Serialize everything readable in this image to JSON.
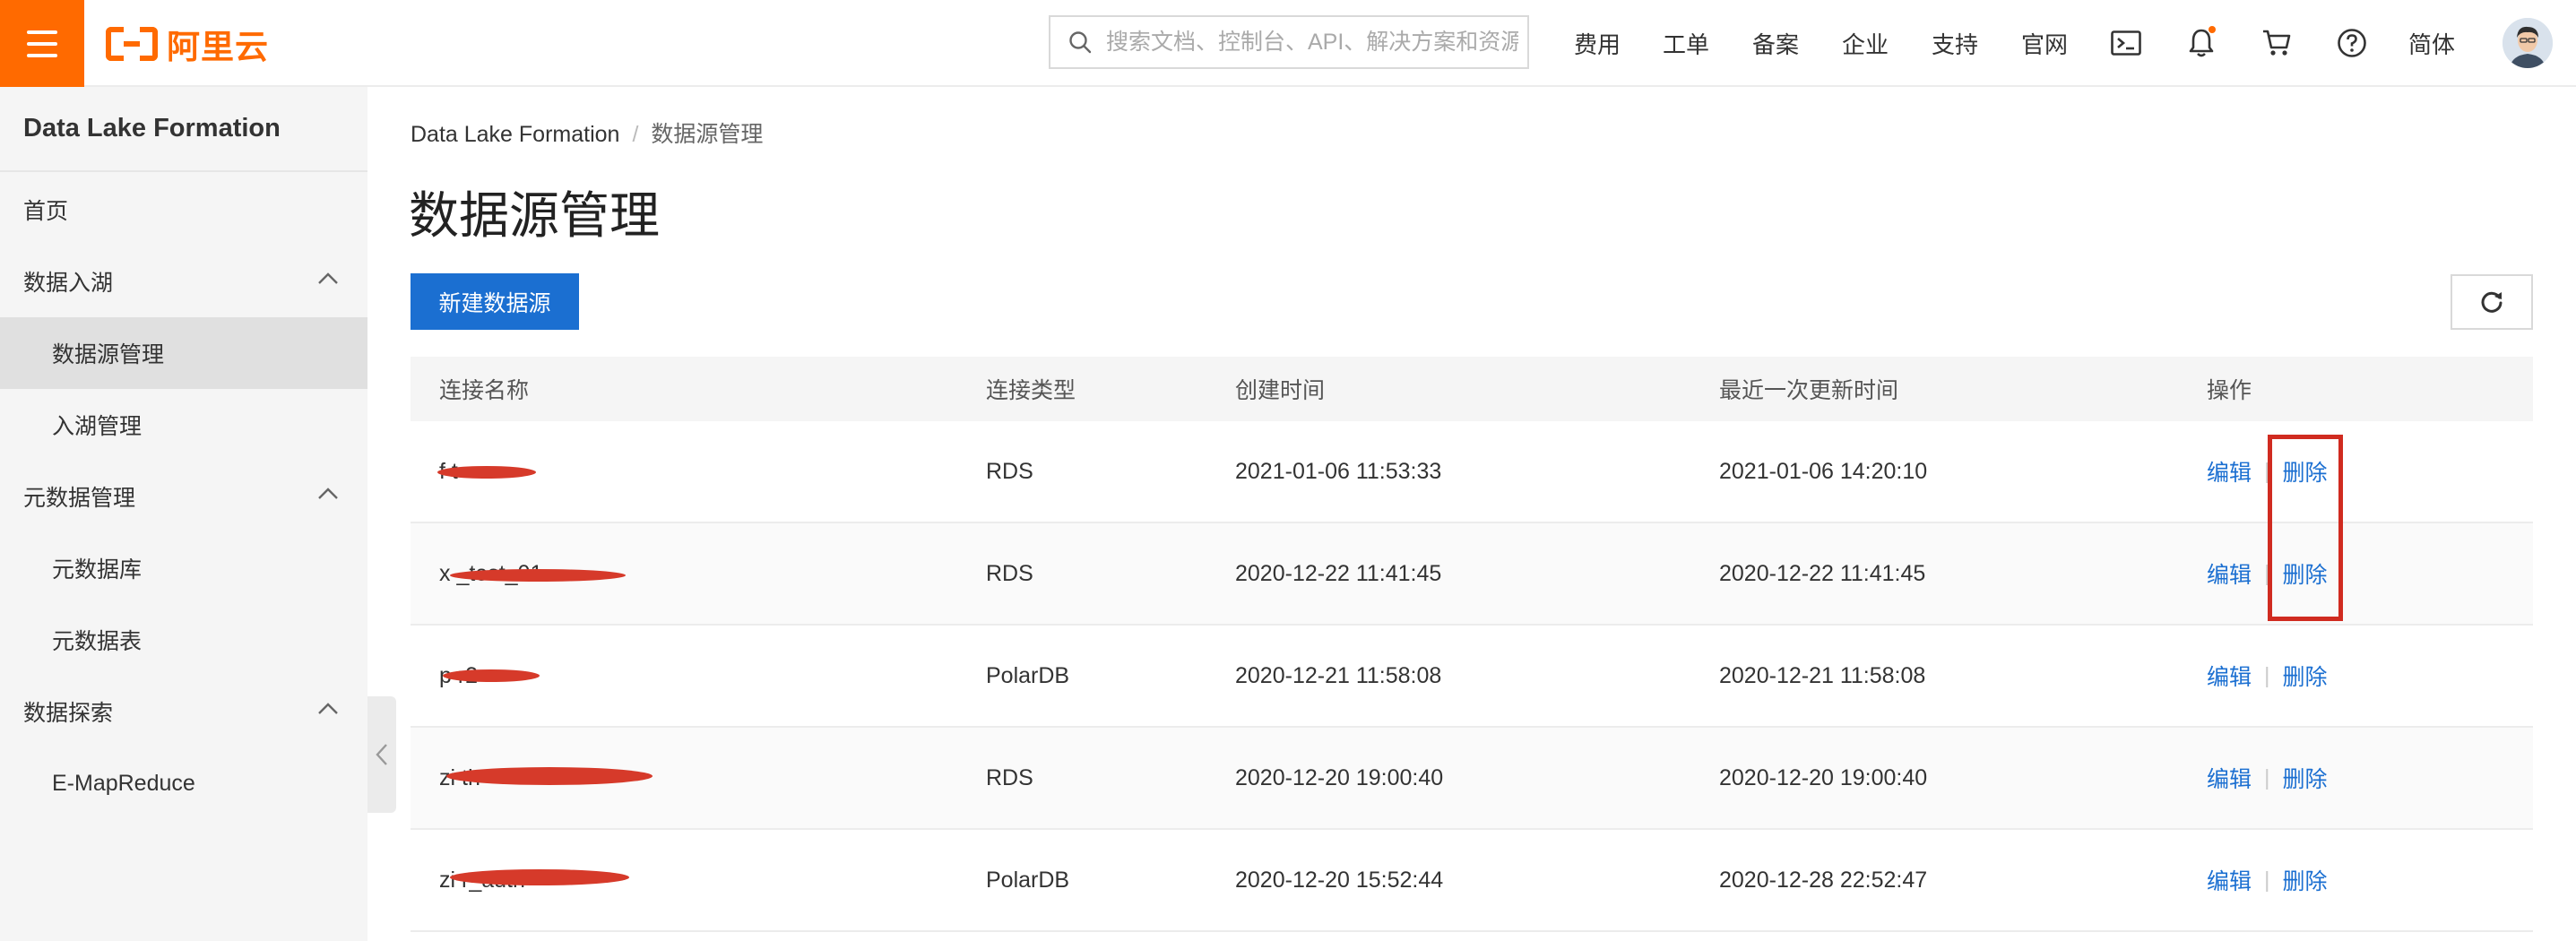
{
  "header": {
    "logo_text": "阿里云",
    "search_placeholder": "搜索文档、控制台、API、解决方案和资源",
    "links": [
      "费用",
      "工单",
      "备案",
      "企业",
      "支持",
      "官网"
    ],
    "lang": "简体",
    "icons": [
      "menu-icon",
      "search-icon",
      "terminal-icon",
      "bell-icon",
      "cart-icon",
      "help-icon",
      "avatar"
    ],
    "accent": "#ff6a00"
  },
  "sidebar": {
    "title": "Data Lake Formation",
    "items": [
      {
        "label": "首页",
        "level": 1
      },
      {
        "label": "数据入湖",
        "level": 1,
        "expanded": true
      },
      {
        "label": "数据源管理",
        "level": 2,
        "active": true
      },
      {
        "label": "入湖管理",
        "level": 2
      },
      {
        "label": "元数据管理",
        "level": 1,
        "expanded": true
      },
      {
        "label": "元数据库",
        "level": 2
      },
      {
        "label": "元数据表",
        "level": 2
      },
      {
        "label": "数据探索",
        "level": 1,
        "expanded": true
      },
      {
        "label": "E-MapReduce",
        "level": 2
      }
    ]
  },
  "breadcrumb": {
    "root": "Data Lake Formation",
    "separator": "/",
    "current": "数据源管理"
  },
  "page": {
    "title": "数据源管理",
    "new_button": "新建数据源",
    "primary_color": "#1b6fd1"
  },
  "table": {
    "columns": [
      "连接名称",
      "连接类型",
      "创建时间",
      "最近一次更新时间",
      "操作"
    ],
    "rows": [
      {
        "name": "f          t",
        "type": "RDS",
        "created": "2021-01-06 11:53:33",
        "updated": "2021-01-06 14:20:10",
        "edit": "编辑",
        "delete": "删除"
      },
      {
        "name": "x              _test_01",
        "type": "RDS",
        "created": "2020-12-22 11:41:45",
        "updated": "2020-12-22 11:41:45",
        "edit": "编辑",
        "delete": "删除"
      },
      {
        "name": "p         r2",
        "type": "PolarDB",
        "created": "2020-12-21 11:58:08",
        "updated": "2020-12-21 11:58:08",
        "edit": "编辑",
        "delete": "删除"
      },
      {
        "name": "zi                   th",
        "type": "RDS",
        "created": "2020-12-20 19:00:40",
        "updated": "2020-12-20 19:00:40",
        "edit": "编辑",
        "delete": "删除"
      },
      {
        "name": "zi                 r_auth",
        "type": "PolarDB",
        "created": "2020-12-20 15:52:44",
        "updated": "2020-12-28 22:52:47",
        "edit": "编辑",
        "delete": "删除"
      }
    ]
  }
}
